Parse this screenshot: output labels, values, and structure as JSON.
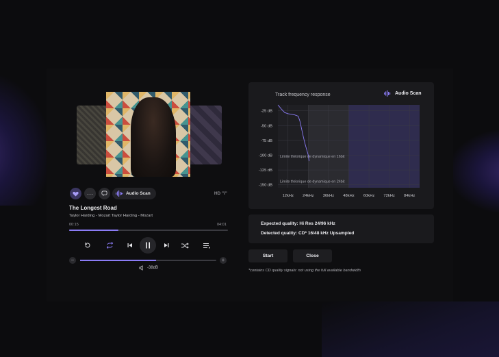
{
  "player": {
    "audio_scan_label": "Audio Scan",
    "hd_badge": "HD \"i\"",
    "track_title": "The Longest Road",
    "track_artist": "Taylor Harding - Mozart Taylor Harding - Mozart",
    "time_current": "00:15",
    "time_total": "04:01",
    "progress": 0.31,
    "volume_level": 0.56,
    "volume_readout": "-38dB"
  },
  "frequency": {
    "title": "Track  frequency response",
    "scan_label": "Audio Scan",
    "annotation_16bit": "Limite théorique de dynamique en 16bit",
    "annotation_24bit": "Limite théorique de dynamique en 24bit"
  },
  "chart_data": {
    "type": "line",
    "title": "Track  frequency response",
    "xlabel": "",
    "ylabel": "",
    "x_ticks": [
      "12kHz",
      "24kHz",
      "36kHz",
      "48kHz",
      "60kHz",
      "72kHz",
      "84kHz"
    ],
    "y_ticks": [
      "-25 dB",
      "-50 dB",
      "-75 dB",
      "-100 dB",
      "-125 dB",
      "-150 dB"
    ],
    "xlim": [
      6,
      90
    ],
    "ylim": [
      -155,
      -15
    ],
    "grid": true,
    "series": [
      {
        "x": [
          6,
          8,
          10,
          12,
          14,
          16,
          18,
          19,
          20,
          21,
          22,
          23,
          24,
          24.5
        ],
        "y": [
          -5,
          -22,
          -28,
          -30,
          -31,
          -32,
          -34,
          -42,
          -55,
          -68,
          -80,
          -90,
          -100,
          -110
        ]
      }
    ],
    "shaded_regions": [
      {
        "x_from": 24,
        "x_to": 48,
        "color": "#2b2b30"
      },
      {
        "x_from": 48,
        "x_to": 90,
        "color": "#2f2c4e"
      }
    ],
    "annotations": [
      {
        "text": "Limite théorique de dynamique en 16bit",
        "y": -102
      },
      {
        "text": "Limite théorique de dynamique en 24bit",
        "y": -144
      }
    ]
  },
  "quality": {
    "expected": "Expected quality: Hi Res 24/96 kHz",
    "detected": "Detected quality: CD* 16/48 kHz Upsampled"
  },
  "buttons": {
    "start": "Start",
    "close": "Close"
  },
  "footnote": "*contains CD quality signals: not using the full available bandwidth",
  "colors": {
    "accent": "#8b7cf6",
    "card": "#1a1a1d",
    "background": "#0c0c0e"
  }
}
